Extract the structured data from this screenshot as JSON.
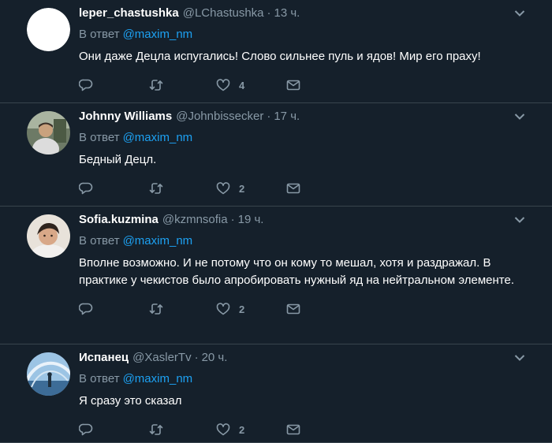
{
  "tweets": [
    {
      "name": "leper_chastushka",
      "handle": "@LChastushka",
      "time": "13 ч.",
      "reply_prefix": "В ответ",
      "reply_to": "@maxim_nm",
      "text": "Они даже Децла испугались! Слово сильнее пуль и ядов! Мир его праху!",
      "likes": "4",
      "avatar": "white-circle"
    },
    {
      "name": "Johnny Williams",
      "handle": "@Johnbissecker",
      "time": "17 ч.",
      "reply_prefix": "В ответ",
      "reply_to": "@maxim_nm",
      "text": "Бедный Децл.",
      "likes": "2",
      "avatar": "man-photo"
    },
    {
      "name": "Sofia.kuzmina",
      "handle": "@kzmnsofia",
      "time": "19 ч.",
      "reply_prefix": "В ответ",
      "reply_to": "@maxim_nm",
      "text": "Вполне возможно. И не потому что он кому то мешал, хотя и раздражал. В практике у чекистов было апробировать нужный яд на нейтральном элементе.",
      "likes": "2",
      "avatar": "woman-photo"
    },
    {
      "name": "Испанец",
      "handle": "@XaslerTv",
      "time": "20 ч.",
      "reply_prefix": "В ответ",
      "reply_to": "@maxim_nm",
      "text": "Я сразу это сказал",
      "likes": "2",
      "avatar": "landscape-photo"
    }
  ],
  "separator": "·",
  "colors": {
    "background": "#15202b",
    "muted": "#8899a6",
    "link": "#1da1f2",
    "divider": "#38444d"
  }
}
